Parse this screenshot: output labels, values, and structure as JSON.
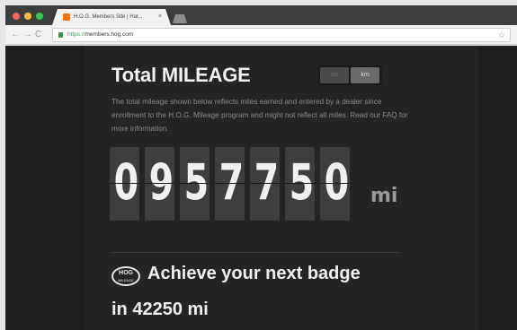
{
  "browser": {
    "tab_title": "H.O.G. Members Site | Har...",
    "tab_close": "×",
    "url_scheme": "https://",
    "url_host": "members.hog.com",
    "back": "←",
    "forward": "→",
    "reload": "C",
    "bookmark": "☆"
  },
  "page": {
    "title": "Total MILEAGE",
    "units": {
      "mi": "mi",
      "km": "km"
    },
    "description": "The total mileage shown below reflects miles earned and entered by a dealer since enrollment to the H.O.G. Mileage program and might not reflect all miles. Read our FAQ for more information.",
    "odometer_digits": [
      "0",
      "9",
      "5",
      "7",
      "7",
      "5",
      "0"
    ],
    "odometer_unit": "mi",
    "badge_icon_top": "HOG",
    "badge_icon_bottom": "MILEAGE",
    "badge_title": "Achieve your next badge",
    "badge_subtitle": "in 42250 mi"
  }
}
